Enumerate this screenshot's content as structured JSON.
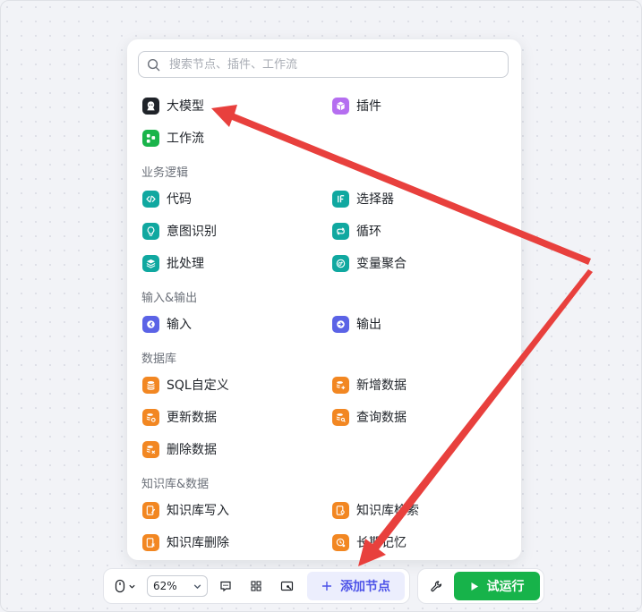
{
  "search": {
    "placeholder": "搜索节点、插件、工作流"
  },
  "top_items": [
    {
      "label": "大模型",
      "icon": "llm-icon",
      "color": "#1f2329"
    },
    {
      "label": "插件",
      "icon": "plugin-icon",
      "color": "#b56ef0"
    },
    {
      "label": "工作流",
      "icon": "workflow-icon",
      "color": "#19b44a"
    }
  ],
  "sections": [
    {
      "title": "业务逻辑",
      "items": [
        {
          "label": "代码",
          "icon": "code-icon"
        },
        {
          "label": "选择器",
          "icon": "if-selector-icon"
        },
        {
          "label": "意图识别",
          "icon": "intent-icon"
        },
        {
          "label": "循环",
          "icon": "loop-icon"
        },
        {
          "label": "批处理",
          "icon": "batch-icon"
        },
        {
          "label": "变量聚合",
          "icon": "variable-merge-icon"
        }
      ]
    },
    {
      "title": "输入&输出",
      "items": [
        {
          "label": "输入",
          "icon": "input-icon"
        },
        {
          "label": "输出",
          "icon": "output-icon"
        }
      ]
    },
    {
      "title": "数据库",
      "items": [
        {
          "label": "SQL自定义",
          "icon": "sql-icon"
        },
        {
          "label": "新增数据",
          "icon": "db-add-icon"
        },
        {
          "label": "更新数据",
          "icon": "db-update-icon"
        },
        {
          "label": "查询数据",
          "icon": "db-query-icon"
        },
        {
          "label": "删除数据",
          "icon": "db-delete-icon"
        }
      ]
    },
    {
      "title": "知识库&数据",
      "items": [
        {
          "label": "知识库写入",
          "icon": "kb-write-icon"
        },
        {
          "label": "知识库检索",
          "icon": "kb-search-icon"
        },
        {
          "label": "知识库删除",
          "icon": "kb-delete-icon"
        },
        {
          "label": "长期记忆",
          "icon": "memory-icon"
        }
      ]
    }
  ],
  "toolbar": {
    "zoom": "62%",
    "add_node_label": "添加节点",
    "test_run_label": "试运行"
  },
  "colors": {
    "accent": "#4d53e8",
    "run_green": "#17b34a",
    "annotation_arrow": "#e8403d"
  }
}
